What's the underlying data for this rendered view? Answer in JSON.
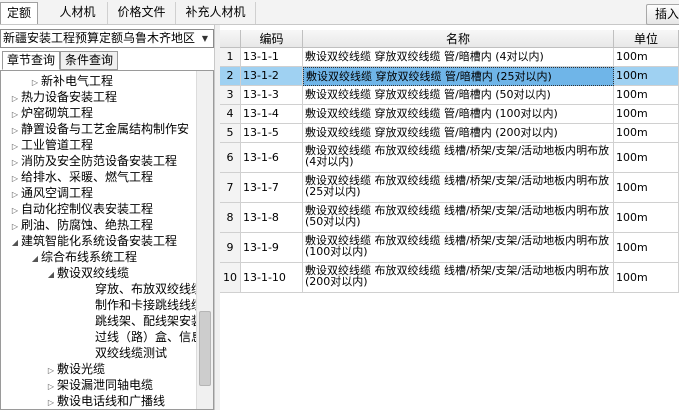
{
  "top_tabs": [
    "定额",
    "人材机",
    "价格文件",
    "补充人材机"
  ],
  "insert_button": "插入",
  "region_select": "新疆安装工程预算定额乌鲁木齐地区",
  "sub_tabs": [
    "章节查询",
    "条件查询"
  ],
  "tree": [
    {
      "label": "新补电气工程",
      "arrow": "▷",
      "level": 2
    },
    {
      "label": "热力设备安装工程",
      "arrow": "▷",
      "level": 1
    },
    {
      "label": "炉窑砌筑工程",
      "arrow": "▷",
      "level": 1
    },
    {
      "label": "静置设备与工艺金属结构制作安",
      "arrow": "▷",
      "level": 1
    },
    {
      "label": "工业管道工程",
      "arrow": "▷",
      "level": 1
    },
    {
      "label": "消防及安全防范设备安装工程",
      "arrow": "▷",
      "level": 1
    },
    {
      "label": "给排水、采暖、燃气工程",
      "arrow": "▷",
      "level": 1
    },
    {
      "label": "通风空调工程",
      "arrow": "▷",
      "level": 1
    },
    {
      "label": "自动化控制仪表安装工程",
      "arrow": "▷",
      "level": 1
    },
    {
      "label": "刷油、防腐蚀、绝热工程",
      "arrow": "▷",
      "level": 1
    },
    {
      "label": "建筑智能化系统设备安装工程",
      "arrow": "◢",
      "level": 1
    },
    {
      "label": "综合布线系统工程",
      "arrow": "◢",
      "level": 2
    },
    {
      "label": "敷设双绞线缆",
      "arrow": "◢",
      "level": 3
    },
    {
      "label": "穿放、布放双绞线缆",
      "arrow": "",
      "level": 4
    },
    {
      "label": "制作和卡接跳线线缆",
      "arrow": "",
      "level": 4
    },
    {
      "label": "跳线架、配线架安装",
      "arrow": "",
      "level": 4
    },
    {
      "label": "过线（路）盒、信息",
      "arrow": "",
      "level": 4
    },
    {
      "label": "双绞线缆测试",
      "arrow": "",
      "level": 4
    },
    {
      "label": "敷设光缆",
      "arrow": "▷",
      "level": 3
    },
    {
      "label": "架设漏泄同轴电缆",
      "arrow": "▷",
      "level": 3
    },
    {
      "label": "敷设电话线和广播线",
      "arrow": "▷",
      "level": 3
    }
  ],
  "grid": {
    "headers": [
      "",
      "编码",
      "名称",
      "单位"
    ],
    "rows": [
      {
        "idx": "1",
        "code": "13-1-1",
        "name": "敷设双绞线缆 穿放双绞线缆 管/暗槽内 (4对以内)",
        "unit": "100m"
      },
      {
        "idx": "2",
        "code": "13-1-2",
        "name": "敷设双绞线缆 穿放双绞线缆 管/暗槽内 (25对以内)",
        "unit": "100m"
      },
      {
        "idx": "3",
        "code": "13-1-3",
        "name": "敷设双绞线缆 穿放双绞线缆 管/暗槽内 (50对以内)",
        "unit": "100m"
      },
      {
        "idx": "4",
        "code": "13-1-4",
        "name": "敷设双绞线缆 穿放双绞线缆 管/暗槽内 (100对以内)",
        "unit": "100m"
      },
      {
        "idx": "5",
        "code": "13-1-5",
        "name": "敷设双绞线缆 穿放双绞线缆 管/暗槽内 (200对以内)",
        "unit": "100m"
      },
      {
        "idx": "6",
        "code": "13-1-6",
        "name": "敷设双绞线缆 布放双绞线缆 线槽/桥架/支架/活动地板内明布放 (4对以内)",
        "unit": "100m"
      },
      {
        "idx": "7",
        "code": "13-1-7",
        "name": "敷设双绞线缆 布放双绞线缆 线槽/桥架/支架/活动地板内明布放 (25对以内)",
        "unit": "100m"
      },
      {
        "idx": "8",
        "code": "13-1-8",
        "name": "敷设双绞线缆 布放双绞线缆 线槽/桥架/支架/活动地板内明布放 (50对以内)",
        "unit": "100m"
      },
      {
        "idx": "9",
        "code": "13-1-9",
        "name": "敷设双绞线缆 布放双绞线缆 线槽/桥架/支架/活动地板内明布放 (100对以内)",
        "unit": "100m"
      },
      {
        "idx": "10",
        "code": "13-1-10",
        "name": "敷设双绞线缆 布放双绞线缆 线槽/桥架/支架/活动地板内明布放 (200对以内)",
        "unit": "100m"
      }
    ]
  },
  "colors": {
    "selected_row": "#9fd1f2",
    "selected_cell": "#6fb5e8"
  }
}
